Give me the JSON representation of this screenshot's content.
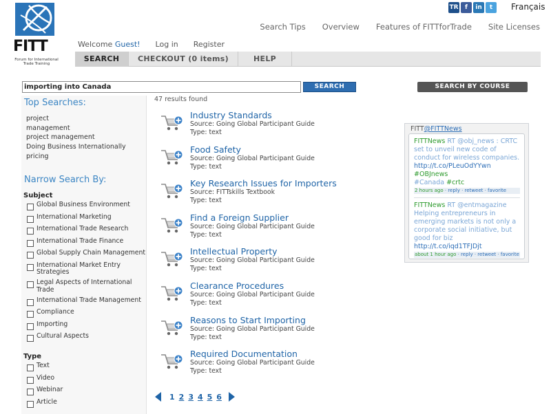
{
  "logo": {
    "title": "FITT",
    "subtitle": "Forum for International Trade Training"
  },
  "social": [
    {
      "name": "tr-icon",
      "label": "TR",
      "color": "#1d4f8a"
    },
    {
      "name": "facebook-icon",
      "label": "f",
      "color": "#3b5b9a"
    },
    {
      "name": "linkedin-icon",
      "label": "in",
      "color": "#2a78b5"
    },
    {
      "name": "twitter-icon",
      "label": "t",
      "color": "#4aa3df"
    }
  ],
  "language": "Français",
  "top_nav": [
    "Search Tips",
    "Overview",
    "Features of FITTforTrade",
    "Site Licenses"
  ],
  "user_bar": {
    "welcome": "Welcome",
    "guest": "Guest!",
    "login": "Log in",
    "register": "Register"
  },
  "tabs": [
    "SEARCH",
    "CHECKOUT (0 items)",
    "HELP"
  ],
  "search": {
    "value": "importing into Canada",
    "button": "SEARCH",
    "by_course": "SEARCH BY COURSE"
  },
  "results_count": "47 results found",
  "sidebar": {
    "top_searches_title": "Top Searches:",
    "top_searches": [
      "project",
      "management",
      "project management",
      "Doing Business Internationally",
      "pricing"
    ],
    "narrow_title": "Narrow Search By:",
    "subject_title": "Subject",
    "subjects": [
      "Global Business Environment",
      "International Marketing",
      "International Trade Research",
      "International Trade Finance",
      "Global Supply Chain Management",
      "International Market Entry Strategies",
      "Legal Aspects of International Trade",
      "International Trade Management",
      "Compliance",
      "Importing",
      "Cultural Aspects"
    ],
    "type_title": "Type",
    "types": [
      "Text",
      "Video",
      "Webinar",
      "Article"
    ]
  },
  "results": [
    {
      "title": "Industry Standards",
      "source": "Source: Going Global Participant Guide",
      "type": "Type: text"
    },
    {
      "title": "Food Safety",
      "source": "Source: Going Global Participant Guide",
      "type": "Type: text"
    },
    {
      "title": "Key Research Issues for Importers",
      "source": "Source: FITTskills Textbook",
      "type": "Type: text"
    },
    {
      "title": "Find a Foreign Supplier",
      "source": "Source: Going Global Participant Guide",
      "type": "Type: text"
    },
    {
      "title": "Intellectual Property",
      "source": "Source: Going Global Participant Guide",
      "type": "Type: text"
    },
    {
      "title": "Clearance Procedures",
      "source": "Source: Going Global Participant Guide",
      "type": "Type: text"
    },
    {
      "title": "Reasons to Start Importing",
      "source": "Source: Going Global Participant Guide",
      "type": "Type: text"
    },
    {
      "title": "Required Documentation",
      "source": "Source: Going Global Participant Guide",
      "type": "Type: text"
    }
  ],
  "pagination": [
    "1",
    "2",
    "3",
    "4",
    "5",
    "6"
  ],
  "twitter": {
    "header_prefix": "FITT",
    "header_handle": "@FITTNews",
    "tweets": [
      {
        "user": "FITTNews",
        "text": " RT @obj_news : CRTC set to unveil new code of conduct for wireless companies. ",
        "link": "http://t.co/PLeuOdYYwn",
        "tag1": " #OBJnews",
        "tag2a": "#Canada",
        "tag2b": " #crtc",
        "time": "2 hours ago",
        "actions": " · reply · retweet · favorite"
      },
      {
        "user": "FITTNews",
        "text": " RT @entmagazine Helping entrepreneurs in emerging markets is not only a corporate social initiative, but good for biz ",
        "link": "http://t.co/iqd1TFJDjt",
        "time": "about 1 hour ago",
        "actions": " · reply · retweet · favorite"
      }
    ]
  }
}
